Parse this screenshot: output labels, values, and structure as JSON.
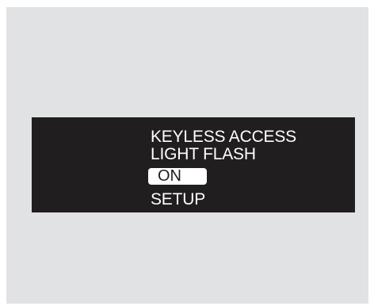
{
  "display": {
    "title_line1": "KEYLESS ACCESS",
    "title_line2": "LIGHT FLASH",
    "selected_option": "ON",
    "footer_label": "SETUP"
  },
  "colors": {
    "background_panel": "#e1e2e3",
    "display_background": "#201e1e",
    "text": "#ffffff",
    "highlight": "#ffffff"
  }
}
